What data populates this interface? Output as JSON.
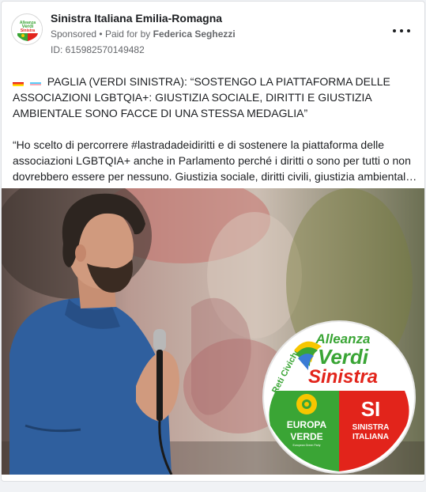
{
  "post": {
    "page_name": "Sinistra Italiana Emilia-Romagna",
    "sponsored_label": "Sponsored",
    "separator": "•",
    "paid_for_prefix": "Paid for by",
    "paid_for_name": "Federica Seghezzi",
    "ad_id": "ID: 615982570149482",
    "more_icon": "more-horizontal-icon",
    "headline_flags": [
      "rainbow-flag-icon",
      "transgender-flag-icon"
    ],
    "headline": "PAGLIA (VERDI SINISTRA): “SOSTENGO LA PIATTAFORMA DELLE ASSOCIAZIONI LGBTQIA+: GIUSTIZIA SOCIALE, DIRITTI E GIUSTIZIA AMBIENTALE SONO FACCE DI UNA STESSA MEDAGLIA”",
    "body_text": "“Ho scelto di percorrere #lastradadeidiritti e di sostenere la piattaforma delle associazioni LGBTQIA+ anche in Parlamento perché i diritti o sono per tutti o non dovrebbero essere per nessuno. Giustizia sociale, diritti civili, giustizia ambiental…"
  },
  "image": {
    "logo": {
      "top_word": "Alleanza",
      "middle_word": "Verdi",
      "bottom_word": "Sinistra",
      "arc_text": "Reti Civiche",
      "left_lines": [
        "EUROPA",
        "VERDE"
      ],
      "left_small": "European Green Party",
      "right_mark": "SI",
      "right_lines": [
        "SINISTRA",
        "ITALIANA"
      ]
    },
    "colors": {
      "green": "#3aa535",
      "red": "#e2241b",
      "yellow": "#f7c600",
      "shirt_blue": "#2f5f9e"
    }
  }
}
